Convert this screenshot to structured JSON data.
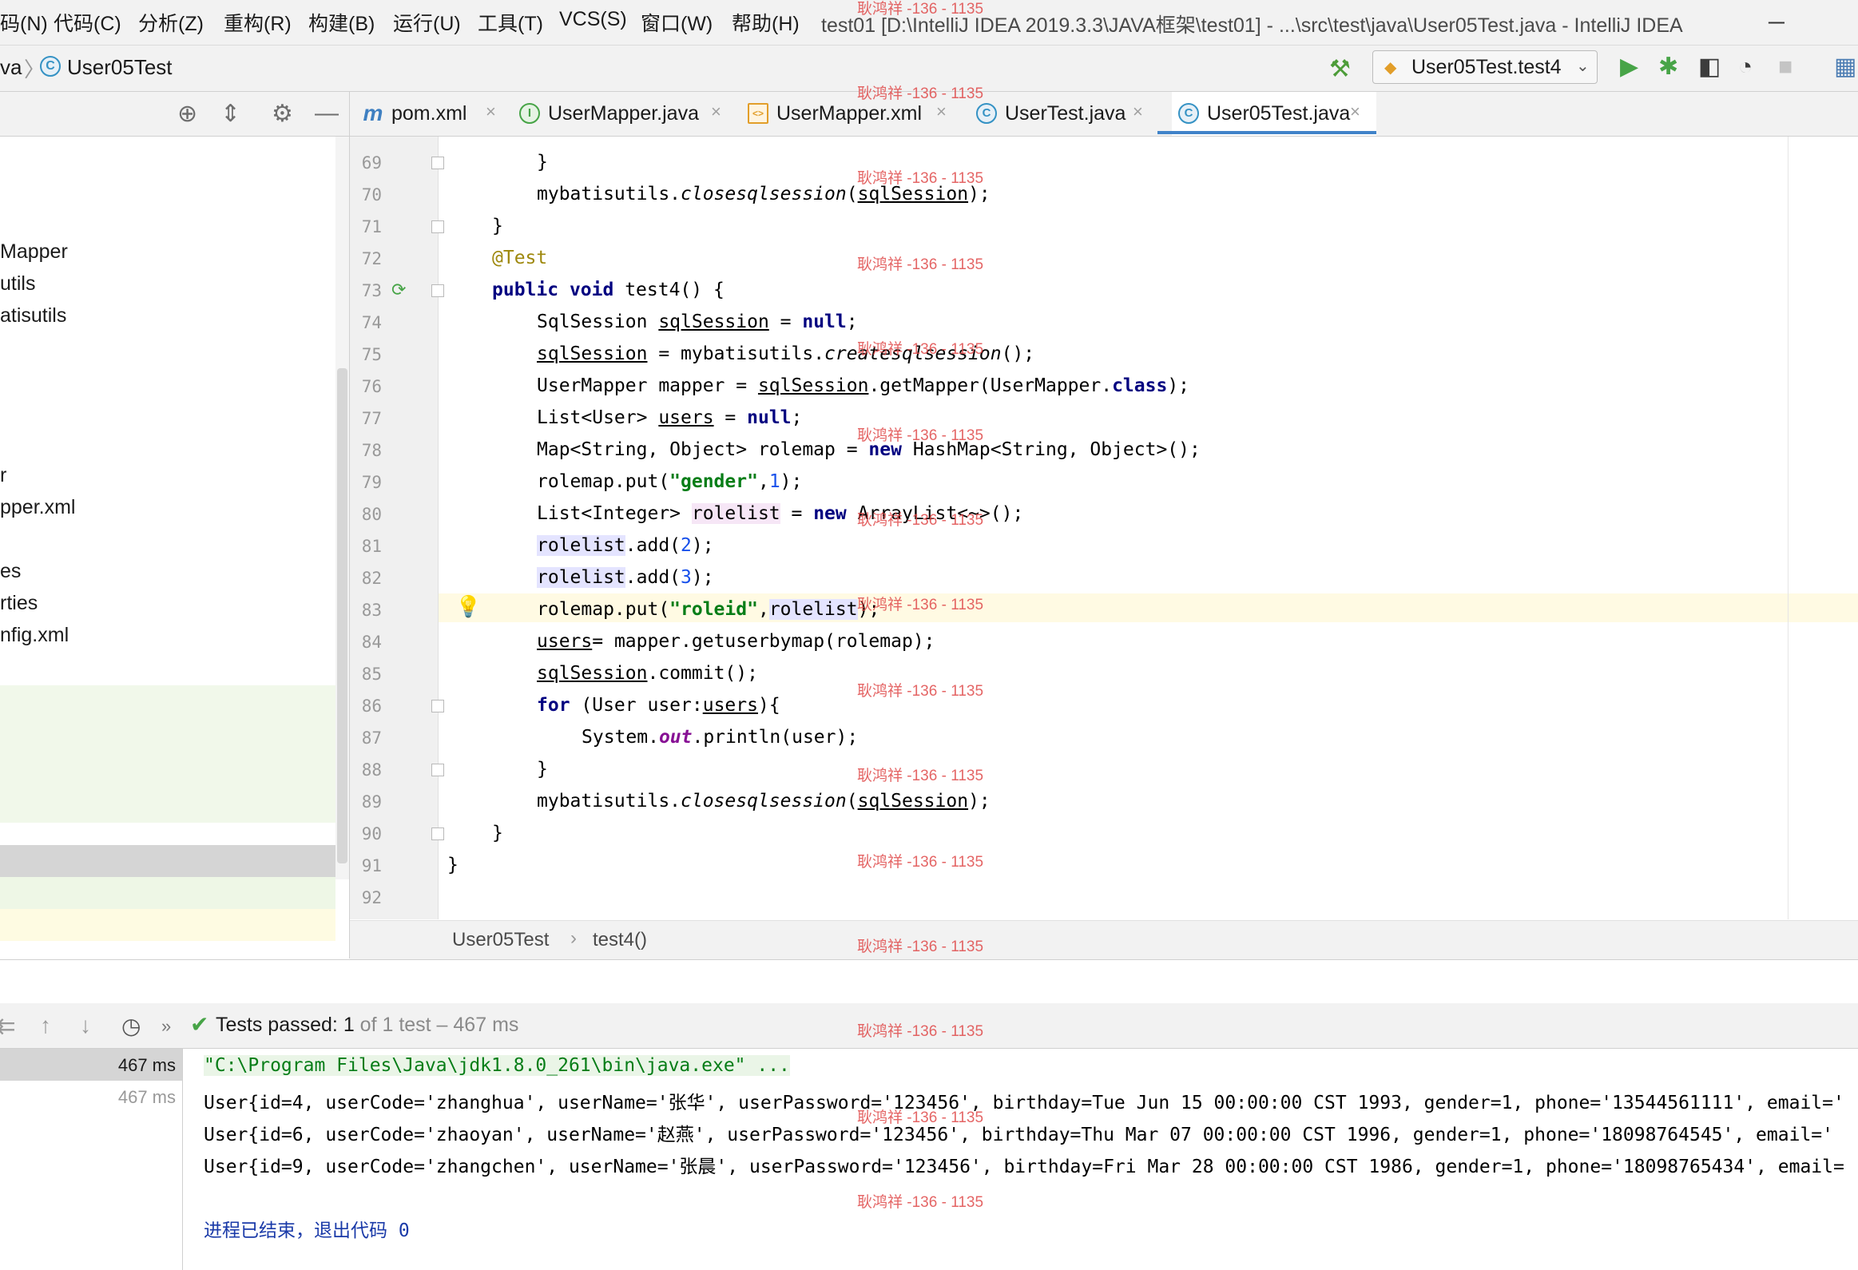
{
  "menu": {
    "items": [
      "码(N)",
      "代码(C)",
      "分析(Z)",
      "重构(R)",
      "构建(B)",
      "运行(U)",
      "工具(T)",
      "VCS(S)",
      "窗口(W)",
      "帮助(H)"
    ],
    "window_title": "test01 [D:\\IntelliJ IDEA 2019.3.3\\JAVA框架\\test01] - ...\\src\\test\\java\\User05Test.java - IntelliJ IDEA",
    "minimize_glyph": "─"
  },
  "navbar": {
    "crumb_root": "va",
    "crumb_sep": "〉",
    "class_icon": "C",
    "crumb_file": "User05Test",
    "run_config": "User05Test.test4"
  },
  "project_tree": {
    "items": [
      "Mapper",
      "utils",
      "atisutils",
      "r",
      "pper.xml",
      "es",
      "rties",
      "nfig.xml"
    ]
  },
  "tabs": [
    {
      "icon": "m",
      "label": "pom.xml",
      "icon_color": "#3e7fc1"
    },
    {
      "icon": "I",
      "label": "UserMapper.java",
      "icon_color": "#47a447"
    },
    {
      "icon": "<>",
      "label": "UserMapper.xml",
      "icon_color": "#e29e2a"
    },
    {
      "icon": "C",
      "label": "UserTest.java",
      "icon_color": "#3592c4"
    },
    {
      "icon": "C",
      "label": "User05Test.java",
      "icon_color": "#3592c4"
    }
  ],
  "code": {
    "line_numbers": [
      "69",
      "70",
      "71",
      "72",
      "73",
      "74",
      "75",
      "76",
      "77",
      "78",
      "79",
      "80",
      "81",
      "82",
      "83",
      "84",
      "85",
      "86",
      "87",
      "88",
      "89",
      "90",
      "91",
      "92"
    ],
    "current_line": "83"
  },
  "editor_breadcrumb": {
    "class": "User05Test",
    "sep": "›",
    "method": "test4()"
  },
  "run": {
    "status_bold": "Tests passed:",
    "status_count": "1",
    "status_detail": "of 1 test – 467 ms",
    "tree_times": [
      "467 ms",
      "467 ms"
    ],
    "console_lines": [
      "\"C:\\Program Files\\Java\\jdk1.8.0_261\\bin\\java.exe\" ...",
      "User{id=4, userCode='zhanghua', userName='张华', userPassword='123456', birthday=Tue Jun 15 00:00:00 CST 1993, gender=1, phone='13544561111', email='",
      "User{id=6, userCode='zhaoyan', userName='赵燕', userPassword='123456', birthday=Thu Mar 07 00:00:00 CST 1996, gender=1, phone='18098764545', email='",
      "User{id=9, userCode='zhangchen', userName='张晨', userPassword='123456', birthday=Fri Mar 28 00:00:00 CST 1986, gender=1, phone='18098765434', email=",
      "进程已结束，退出代码 0"
    ]
  },
  "watermark": {
    "text": "耿鸿祥 -136 - 1135"
  },
  "colors": {
    "accent": "#4083c9",
    "pass_green": "#47a447",
    "watermark_red": "#e04b4b"
  }
}
